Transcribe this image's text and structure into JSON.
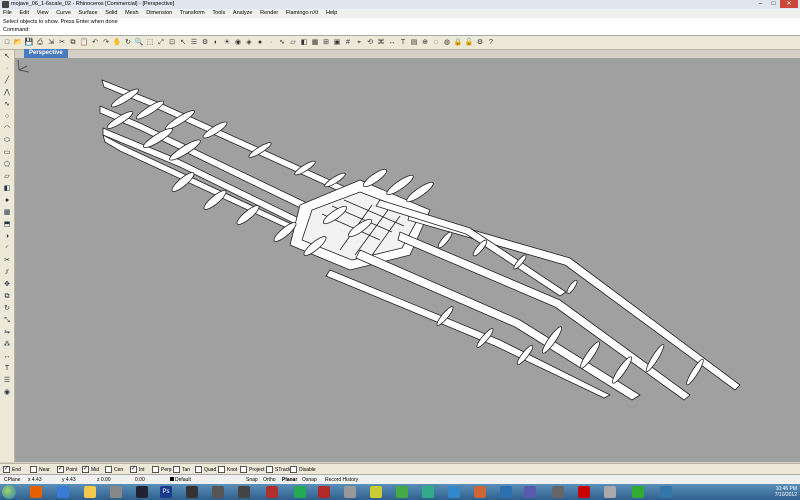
{
  "window": {
    "title": "mojave_06_1-6scale_02 - Rhinoceros [Commercial] - [Perspective]",
    "controls": [
      "–",
      "□",
      "✕"
    ]
  },
  "menu": [
    "File",
    "Edit",
    "View",
    "Curve",
    "Surface",
    "Solid",
    "Mesh",
    "Dimension",
    "Transform",
    "Tools",
    "Analyze",
    "Render",
    "Flamingo nXt",
    "Help"
  ],
  "command": {
    "prompt_history": "Select objects to show. Press Enter when done",
    "label": "Command:"
  },
  "toolbar_icons": [
    "new-icon",
    "open-icon",
    "save-icon",
    "print-icon",
    "import-icon",
    "cut-icon",
    "copy-icon",
    "paste-icon",
    "undo-icon",
    "redo-icon",
    "pan-icon",
    "rotate-icon",
    "zoom-icon",
    "zoom-window-icon",
    "zoom-extents-icon",
    "zoom-selected-icon",
    "select-icon",
    "layer-icon",
    "properties-icon",
    "display-icon",
    "lights-icon",
    "render-icon",
    "material-icon",
    "sphere-icon",
    "point-icon",
    "curve-icon",
    "surface-icon",
    "solid-icon",
    "mesh-icon",
    "cplane-icon",
    "viewport-icon",
    "grid-icon",
    "snap-icon",
    "history-icon",
    "analyze-icon",
    "dimension-icon",
    "text-icon",
    "block-icon",
    "group-icon",
    "hide-icon",
    "show-icon",
    "lock-icon",
    "unlock-icon",
    "options-icon",
    "help-icon"
  ],
  "viewport": {
    "tab_label": "Perspective",
    "background": "#a0a0a0"
  },
  "osnaps": [
    {
      "label": "End",
      "checked": true
    },
    {
      "label": "Near",
      "checked": false
    },
    {
      "label": "Point",
      "checked": true
    },
    {
      "label": "Mid",
      "checked": true
    },
    {
      "label": "Cen",
      "checked": false
    },
    {
      "label": "Int",
      "checked": true
    },
    {
      "label": "Perp",
      "checked": false
    },
    {
      "label": "Tan",
      "checked": false
    },
    {
      "label": "Quad",
      "checked": false
    },
    {
      "label": "Knot",
      "checked": false
    },
    {
      "label": "Project",
      "checked": false
    },
    {
      "label": "STrack",
      "checked": false
    },
    {
      "label": "Disable",
      "checked": false
    }
  ],
  "status": {
    "cplane": "CPlane",
    "x": "x 4.43",
    "y": "y 4.43",
    "z": "z 0.00",
    "units": "0.00",
    "layer": "Default",
    "toggles": [
      "Snap",
      "Ortho",
      "Planar",
      "Osnap",
      "Record History"
    ]
  },
  "taskbar": {
    "time": "10:46 PM",
    "date": "7/10/2012"
  },
  "colors": {
    "title_bg": "#dfe6ef",
    "viewport_tab": "#4a7ac0",
    "model_fill": "#ffffff",
    "model_stroke": "#222222"
  }
}
